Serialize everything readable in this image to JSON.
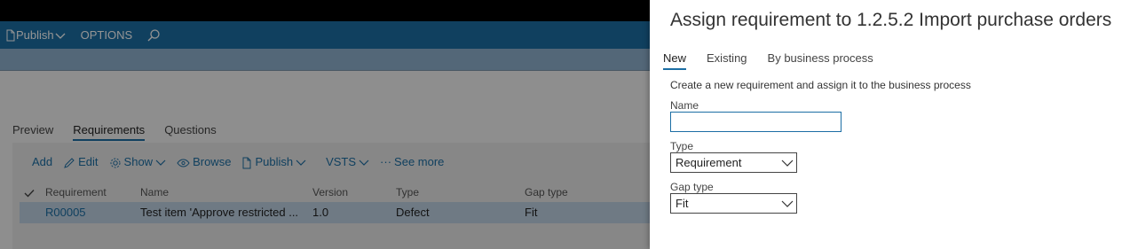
{
  "actionbar": {
    "publish_label": "Publish",
    "options_label": "OPTIONS",
    "search_icon": "search-icon"
  },
  "page_tabs": [
    "Preview",
    "Requirements",
    "Questions"
  ],
  "toolbar": {
    "add": "Add",
    "edit": "Edit",
    "show": "Show",
    "browse": "Browse",
    "publish": "Publish",
    "vsts": "VSTS",
    "see_more": "See more"
  },
  "grid": {
    "headers": [
      "Requirement",
      "Name",
      "Version",
      "Type",
      "Gap type"
    ],
    "rows": [
      [
        "R00005",
        "Test item 'Approve restricted ...",
        "1.0",
        "Defect",
        "Fit"
      ]
    ]
  },
  "dialog": {
    "title": "Assign requirement to 1.2.5.2 Import purchase orders",
    "tabs": [
      "New",
      "Existing",
      "By business process"
    ],
    "description": "Create a new requirement and assign it to the business process",
    "name_label": "Name",
    "name_value": "",
    "type_label": "Type",
    "type_value": "Requirement",
    "gap_label": "Gap type",
    "gap_value": "Fit"
  },
  "colors": {
    "accent": "#1c6ea4",
    "topbar": "#000000",
    "selected_row": "#bfd2e3"
  }
}
